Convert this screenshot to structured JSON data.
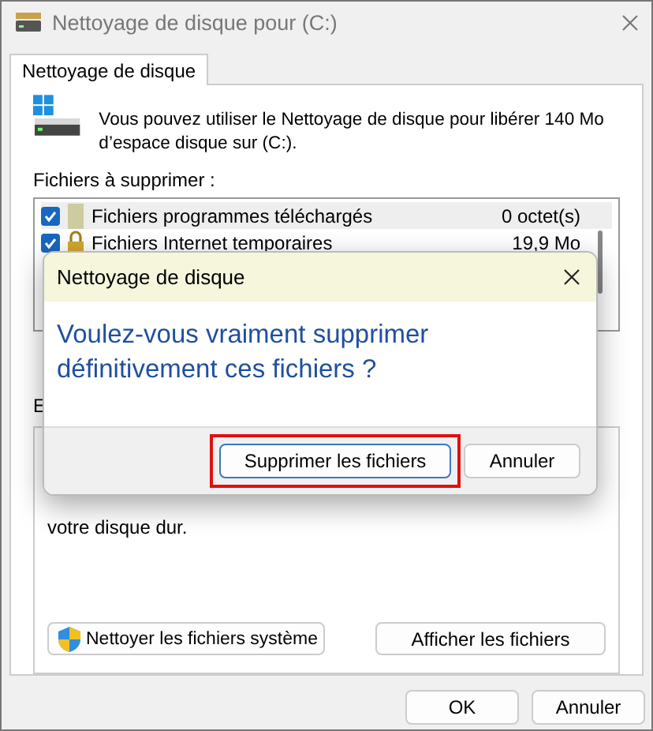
{
  "window": {
    "title": "Nettoyage de disque pour  (C:)"
  },
  "tabs": [
    {
      "label": "Nettoyage de disque",
      "selected": true
    }
  ],
  "intro": "Vous pouvez utiliser le Nettoyage de disque pour libérer 140 Mo d’espace disque sur  (C:).",
  "files_label": "Fichiers à supprimer :",
  "files": [
    {
      "kind": "page",
      "name": "Fichiers programmes téléchargés",
      "size": "0 octet(s)",
      "checked": true,
      "selected": true
    },
    {
      "kind": "lock",
      "name": "Fichiers Internet temporaires",
      "size": "19,9 Mo",
      "checked": true,
      "selected": false
    }
  ],
  "group_label": "E",
  "description": "votre disque dur.",
  "group_buttons": [
    {
      "kind": "shield",
      "label": "Nettoyer les fichiers système"
    },
    {
      "kind": "plain",
      "label": "Afficher les fichiers"
    }
  ],
  "buttons": [
    "OK",
    "Annuler"
  ],
  "dialog": {
    "title": "Nettoyage de disque",
    "message": "Voulez-vous vraiment supprimer définitivement ces fichiers ?",
    "buttons": [
      {
        "label": "Supprimer les fichiers",
        "highlighted": true
      },
      {
        "label": "Annuler",
        "highlighted": false
      }
    ]
  }
}
